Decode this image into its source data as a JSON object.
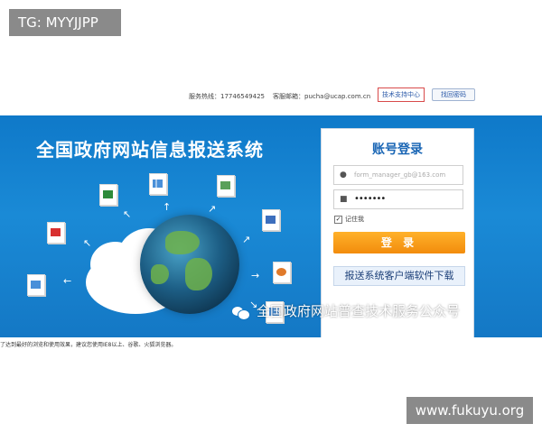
{
  "watermarks": {
    "top_left": "TG: MYYJJPP",
    "bottom_right": "www.fukuyu.org"
  },
  "topbar": {
    "hotline": "服务热线：17746549425",
    "email": "客服邮箱：pucha@ucap.com.cn",
    "support_link": "技术支持中心",
    "retrieve_password": "找回密码"
  },
  "banner": {
    "title": "全国政府网站信息报送系统",
    "wechat_caption": "全国政府网站普查技术服务公众号"
  },
  "login": {
    "title": "账号登录",
    "username_value": "form_manager_gb@163.com",
    "password_mask": "•••••••",
    "remember_label": "记住我",
    "remember_checked": "✓",
    "login_button": "登 录",
    "download_button": "报送系统客户端软件下载"
  },
  "footer": {
    "browser_note": "了达到最好的浏览和使用效果，建议您使用IE8以上、谷歌、火狐浏览器。"
  },
  "icons": [
    "excel-icon",
    "chart-doc-icon",
    "pdf-icon",
    "word-icon",
    "ppt-icon",
    "user-icon",
    "lock-icon",
    "wechat-icon"
  ],
  "colors": {
    "banner_blue": "#1478c5",
    "login_orange": "#f28c0c",
    "title_blue": "#1a66b5"
  }
}
